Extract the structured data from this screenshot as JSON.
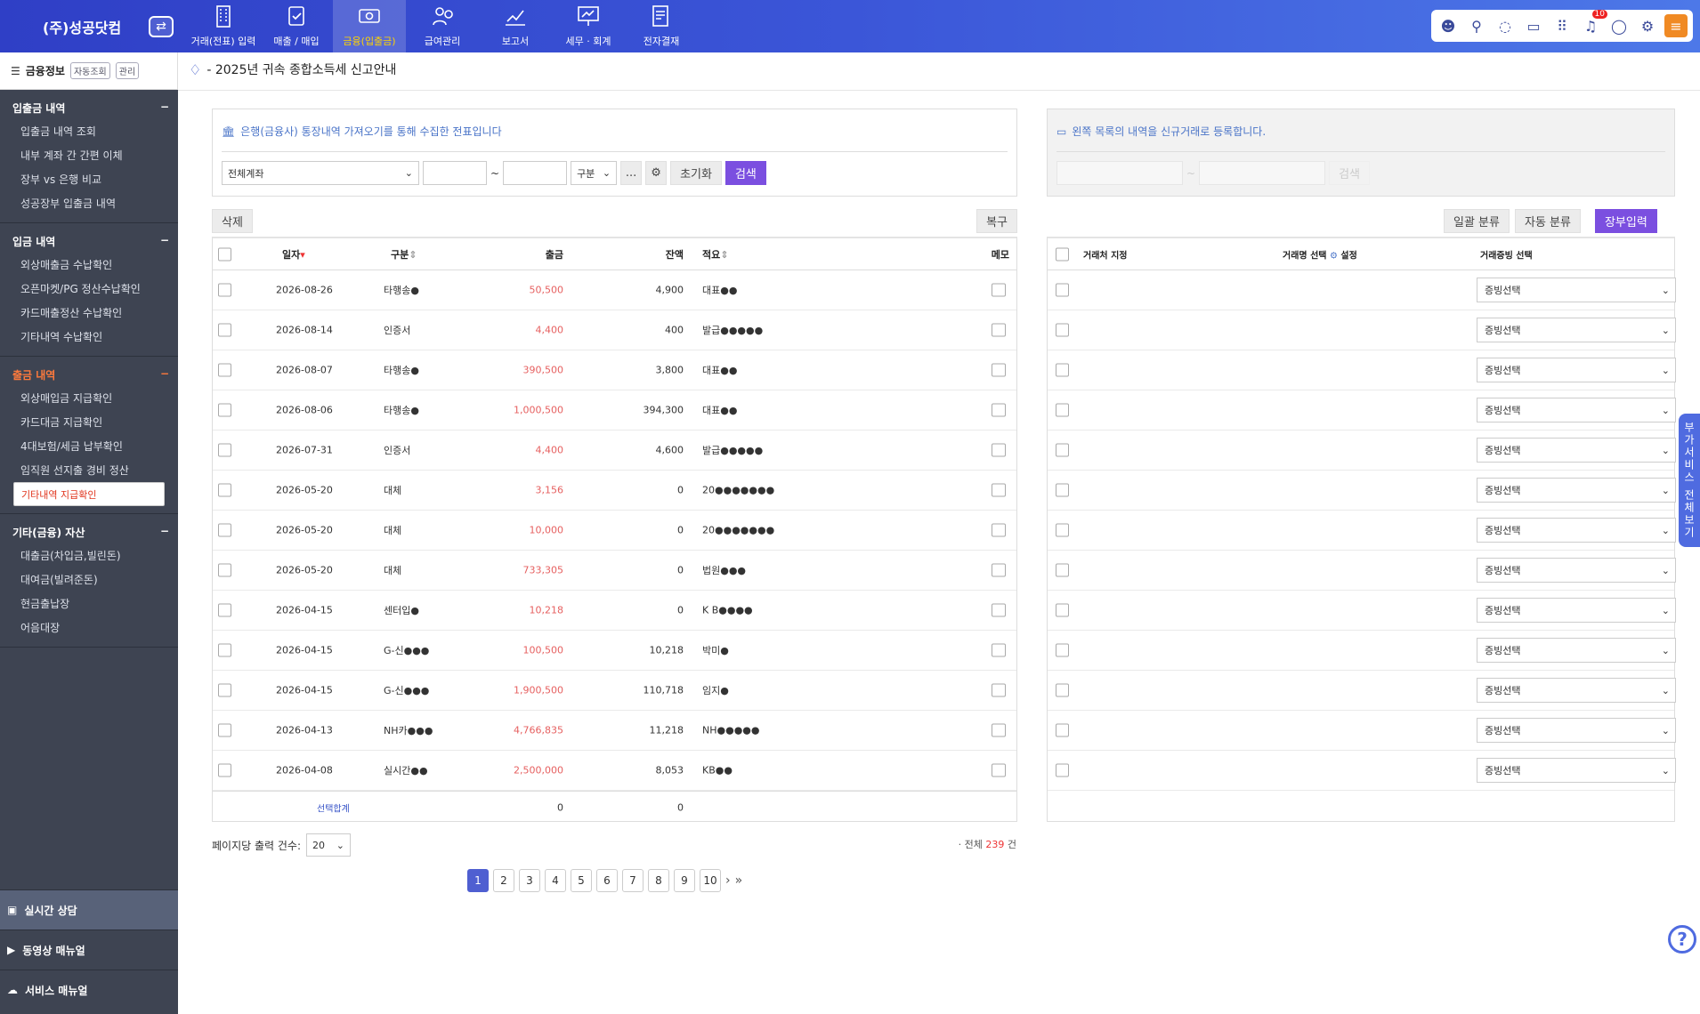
{
  "app": {
    "company": "(주)성공닷컴"
  },
  "nav": [
    {
      "label": "거래(전표) 입력",
      "icon": "building-icon"
    },
    {
      "label": "매출 / 매입",
      "icon": "receipt-check-icon"
    },
    {
      "label": "금융(입출금)",
      "icon": "money-icon",
      "active": true
    },
    {
      "label": "급여관리",
      "icon": "person-coin-icon"
    },
    {
      "label": "보고서",
      "icon": "chart-up-icon"
    },
    {
      "label": "세무 · 회계",
      "icon": "presentation-icon"
    },
    {
      "label": "전자결재",
      "icon": "document-sign-icon"
    }
  ],
  "top_icons": {
    "notification_count": "10"
  },
  "sidebar": {
    "header": {
      "title": "금융정보",
      "btn1": "자동조회",
      "btn2": "관리"
    },
    "groups": [
      {
        "title": "입출금 내역",
        "items": [
          "입출금 내역 조회",
          "내부 계좌 간 간편 이체",
          "장부 vs 은행 비교",
          "성공장부 입출금 내역"
        ]
      },
      {
        "title": "입금 내역",
        "items": [
          "외상매출금 수납확인",
          "오픈마켓/PG 정산수납확인",
          "카드매출정산 수납확인",
          "기타내역 수납확인"
        ]
      },
      {
        "title": "출금 내역",
        "items": [
          "외상매입금 지급확인",
          "카드대금 지급확인",
          "4대보험/세금 납부확인",
          "임직원 선지출 경비 정산",
          "기타내역 지급확인"
        ]
      },
      {
        "title": "기타(금융) 자산",
        "items": [
          "대출금(차입금,빌린돈)",
          "대여금(빌려준돈)",
          "현금출납장",
          "어음대장"
        ]
      }
    ],
    "bottom": [
      "실시간 상담",
      "동영상 매뉴얼",
      "서비스 매뉴얼"
    ]
  },
  "notice": "- 2025년 귀속 종합소득세 신고안내",
  "left_panel": {
    "header": "은행(금융사) 통장내역 가져오기를 통해 수집한 전표입니다",
    "account_select": "전체계좌",
    "tilde": "~",
    "type_select": "구분",
    "more": "...",
    "reset": "초기화",
    "search": "검색"
  },
  "right_panel": {
    "header": "왼쪽 목록의 내역을 신규거래로 등록합니다.",
    "tilde": "~",
    "search": "검색"
  },
  "left_toolbar": {
    "delete": "삭제",
    "restore": "복구"
  },
  "right_toolbar": {
    "bulk": "일괄 분류",
    "auto": "자동 분류",
    "ledger": "장부입력"
  },
  "left_table": {
    "headers": {
      "date": "일자",
      "type": "구분",
      "out": "출금",
      "balance": "잔액",
      "desc": "적요",
      "memo": "메모"
    },
    "rows": [
      {
        "date": "2026-08-26",
        "type": "타행송●",
        "out": "50,500",
        "balance": "4,900",
        "desc": "대표●●"
      },
      {
        "date": "2026-08-14",
        "type": "인증서",
        "out": "4,400",
        "balance": "400",
        "desc": "발급●●●●●"
      },
      {
        "date": "2026-08-07",
        "type": "타행송●",
        "out": "390,500",
        "balance": "3,800",
        "desc": "대표●●"
      },
      {
        "date": "2026-08-06",
        "type": "타행송●",
        "out": "1,000,500",
        "balance": "394,300",
        "desc": "대표●●"
      },
      {
        "date": "2026-07-31",
        "type": "인증서",
        "out": "4,400",
        "balance": "4,600",
        "desc": "발급●●●●●"
      },
      {
        "date": "2026-05-20",
        "type": "대체",
        "out": "3,156",
        "balance": "0",
        "desc": "20●●●●●●●"
      },
      {
        "date": "2026-05-20",
        "type": "대체",
        "out": "10,000",
        "balance": "0",
        "desc": "20●●●●●●●"
      },
      {
        "date": "2026-05-20",
        "type": "대체",
        "out": "733,305",
        "balance": "0",
        "desc": "법원●●●"
      },
      {
        "date": "2026-04-15",
        "type": "센터입●",
        "out": "10,218",
        "balance": "0",
        "desc": "K B●●●●"
      },
      {
        "date": "2026-04-15",
        "type": "G-신●●●",
        "out": "100,500",
        "balance": "10,218",
        "desc": "박미●"
      },
      {
        "date": "2026-04-15",
        "type": "G-신●●●",
        "out": "1,900,500",
        "balance": "110,718",
        "desc": "임지●"
      },
      {
        "date": "2026-04-13",
        "type": "NH카●●●",
        "out": "4,766,835",
        "balance": "11,218",
        "desc": "NH●●●●●"
      },
      {
        "date": "2026-04-08",
        "type": "실시간●●",
        "out": "2,500,000",
        "balance": "8,053",
        "desc": "KB●●"
      }
    ],
    "footer": {
      "label": "선택합계",
      "out": "0",
      "balance": "0"
    }
  },
  "right_table": {
    "headers": {
      "partner": "거래처 지정",
      "name": "거래명 선택",
      "setting": "설정",
      "proof": "거래증빙 선택"
    },
    "proof_value": "증빙선택"
  },
  "per_page": {
    "label": "페이지당 출력 건수:",
    "value": "20"
  },
  "total": {
    "prefix": "· 전체",
    "count": "239",
    "suffix": "건"
  },
  "pages": [
    "1",
    "2",
    "3",
    "4",
    "5",
    "6",
    "7",
    "8",
    "9",
    "10"
  ],
  "side_tab": "부가서비스 전체보기",
  "help": "?"
}
